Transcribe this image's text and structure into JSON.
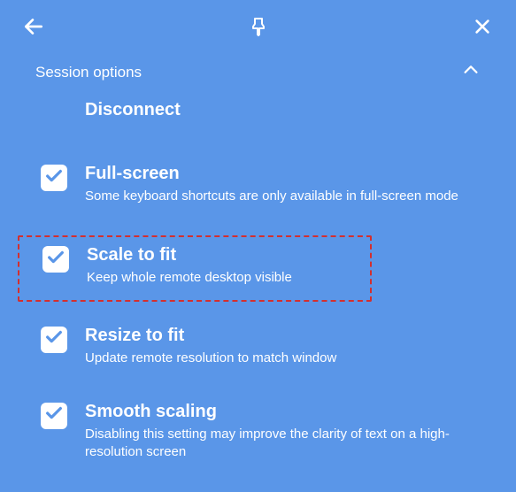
{
  "section": {
    "title": "Session options"
  },
  "disconnect": {
    "label": "Disconnect"
  },
  "options": [
    {
      "label": "Full-screen",
      "description": "Some keyboard shortcuts are only available in full-screen mode",
      "checked": true
    },
    {
      "label": "Scale to fit",
      "description": "Keep whole remote desktop visible",
      "checked": true
    },
    {
      "label": "Resize to fit",
      "description": "Update remote resolution to match window",
      "checked": true
    },
    {
      "label": "Smooth scaling",
      "description": "Disabling this setting may improve the clarity of text on a high-resolution screen",
      "checked": true
    }
  ]
}
